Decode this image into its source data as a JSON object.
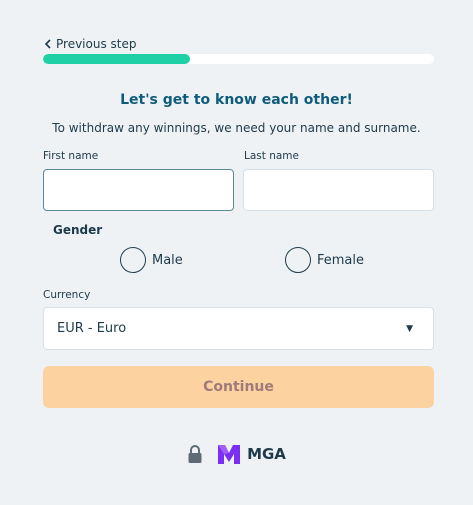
{
  "nav": {
    "back_label": "Previous step"
  },
  "progress": {
    "fraction": 0.375
  },
  "heading": {
    "title": "Let's get to know each other!",
    "subtitle": "To withdraw any winnings, we need your name and surname."
  },
  "form": {
    "first_name": {
      "label": "First name",
      "value": ""
    },
    "last_name": {
      "label": "Last name",
      "value": ""
    },
    "gender": {
      "label": "Gender",
      "options": [
        "Male",
        "Female"
      ]
    },
    "currency": {
      "label": "Currency",
      "selected": "EUR - Euro"
    },
    "continue_label": "Continue"
  },
  "footer": {
    "icons": [
      "lock-icon",
      "mga-logo-icon"
    ],
    "mga_text": "MGA"
  },
  "colors": {
    "accent": "#1fd0a6",
    "title": "#0f5c7a",
    "button_bg": "#fbd2a0",
    "button_text": "#a07a7a",
    "mga_purple": "#7b2ff2"
  }
}
